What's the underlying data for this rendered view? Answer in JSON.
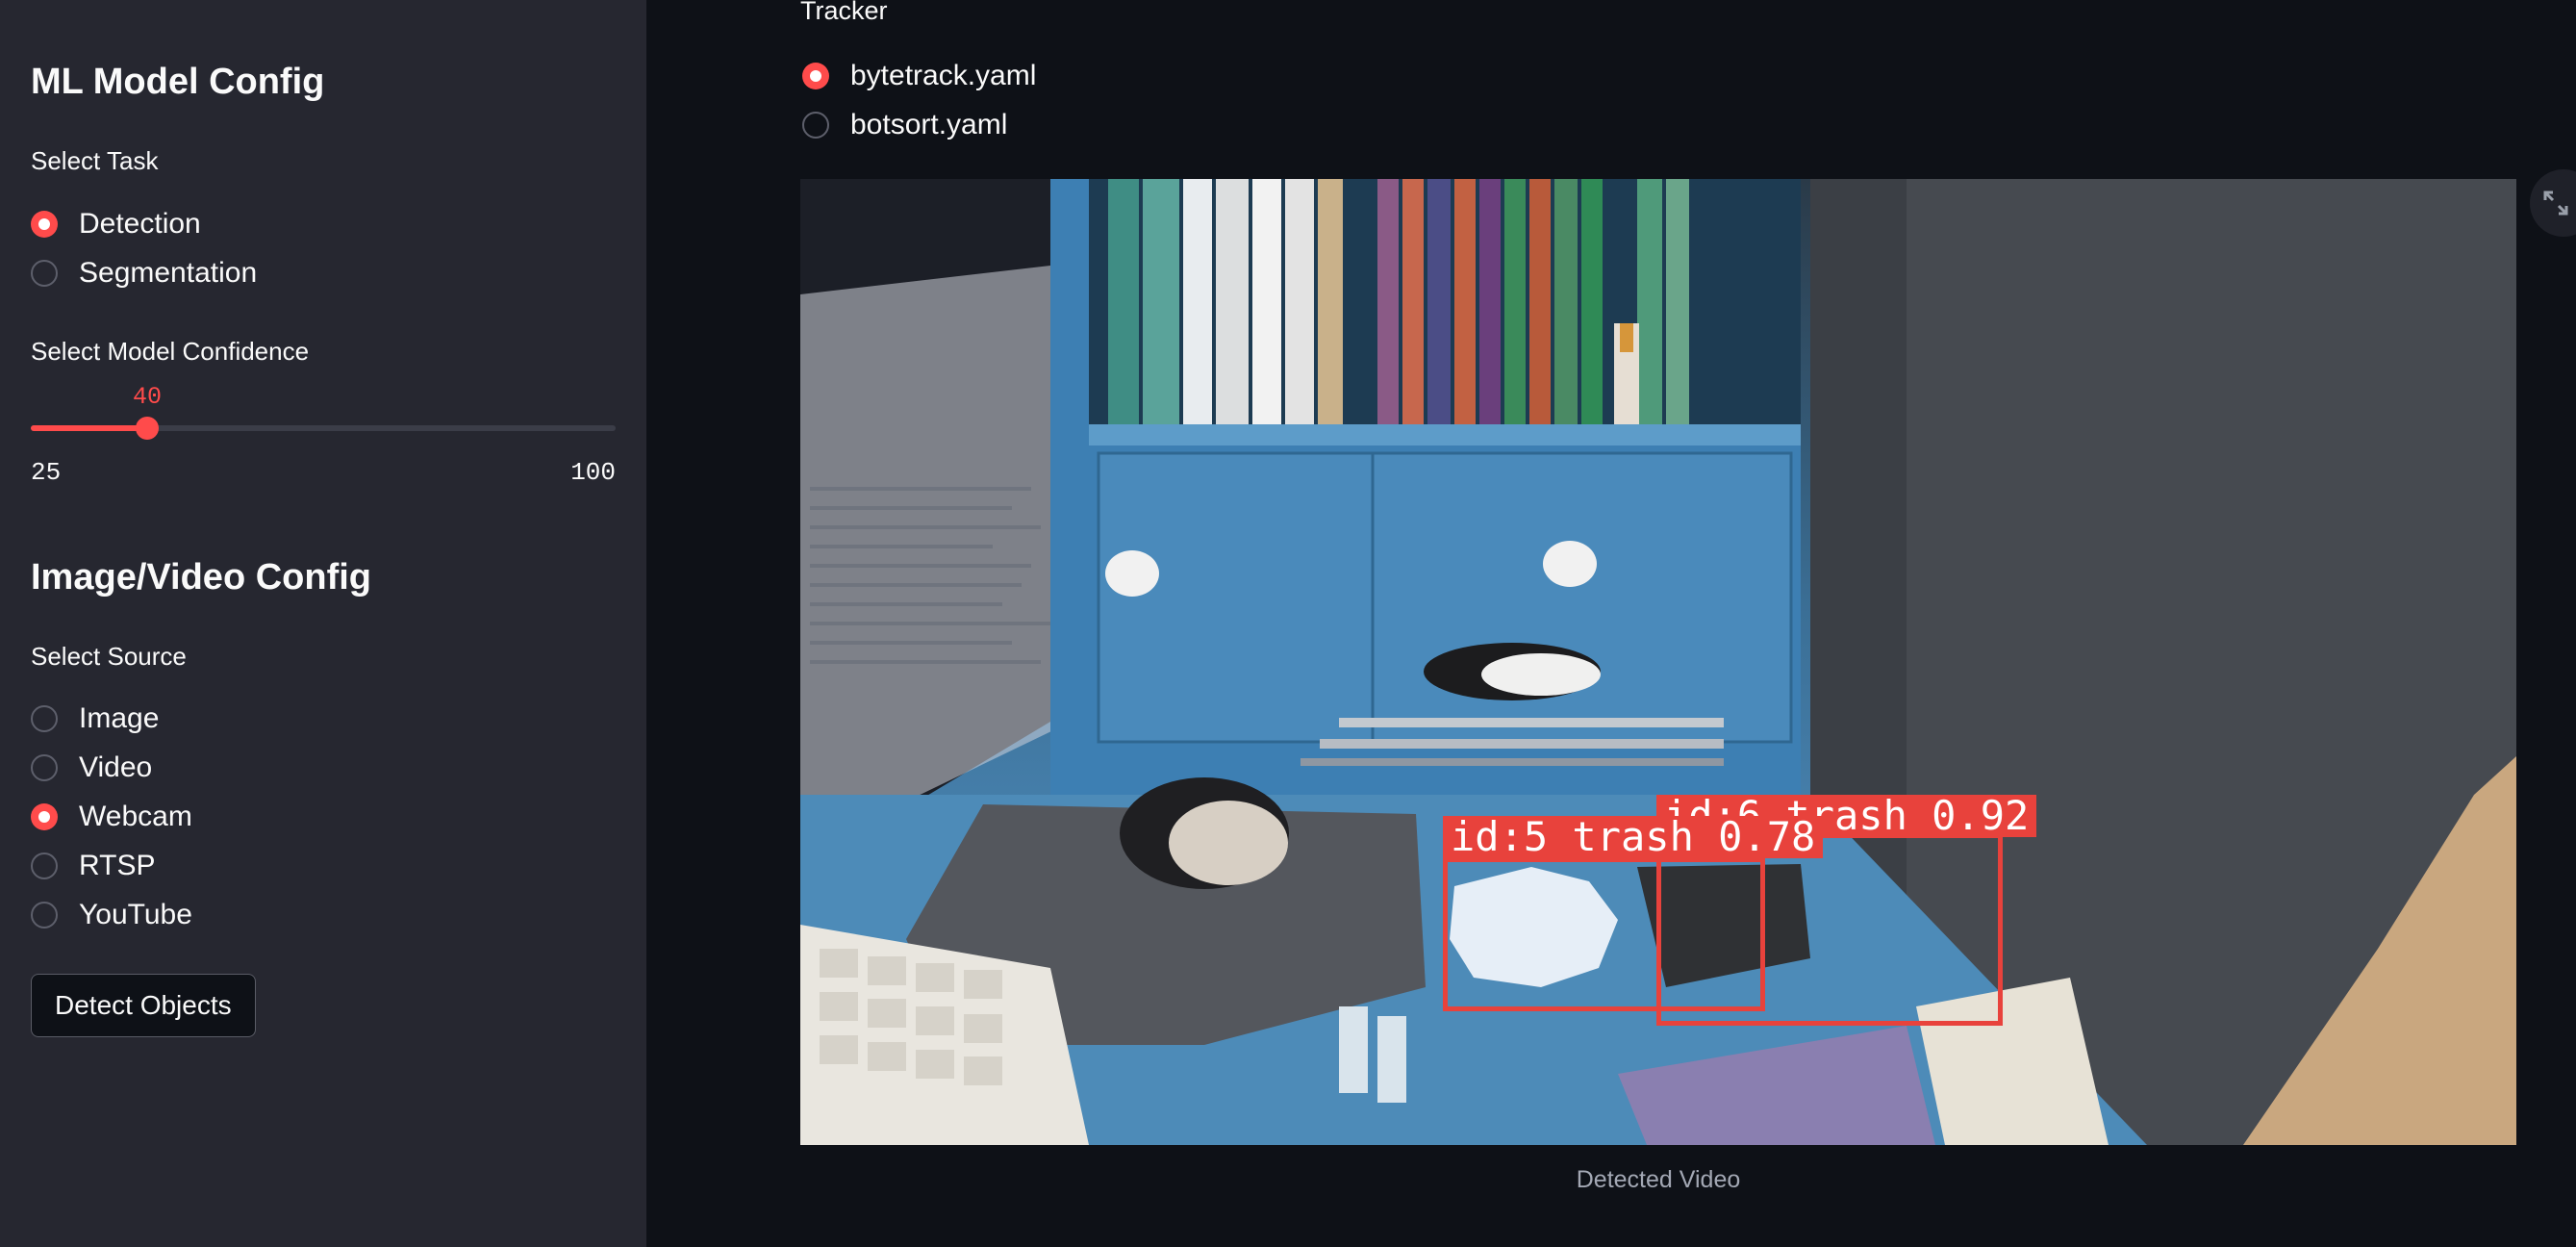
{
  "sidebar": {
    "model_heading": "ML Model Config",
    "task_label": "Select Task",
    "task_options": [
      "Detection",
      "Segmentation"
    ],
    "task_selected": "Detection",
    "confidence_label": "Select Model Confidence",
    "confidence_value": "40",
    "confidence_min": "25",
    "confidence_max": "100",
    "source_heading": "Image/Video Config",
    "source_label": "Select Source",
    "source_options": [
      "Image",
      "Video",
      "Webcam",
      "RTSP",
      "YouTube"
    ],
    "source_selected": "Webcam",
    "detect_button": "Detect Objects"
  },
  "main": {
    "tracker_label": "Tracker",
    "tracker_options": [
      "bytetrack.yaml",
      "botsort.yaml"
    ],
    "tracker_selected": "bytetrack.yaml",
    "detections": [
      {
        "label": "id:5 trash 0.78"
      },
      {
        "label": "id:6 trash 0.92"
      }
    ],
    "video_caption": "Detected Video"
  },
  "colors": {
    "accent": "#ff4b4b",
    "sidebar_bg": "#262730",
    "main_bg": "#0e1117",
    "detection_box": "#e8423c"
  },
  "icons": {
    "expand": "fullscreen-expand-icon"
  }
}
